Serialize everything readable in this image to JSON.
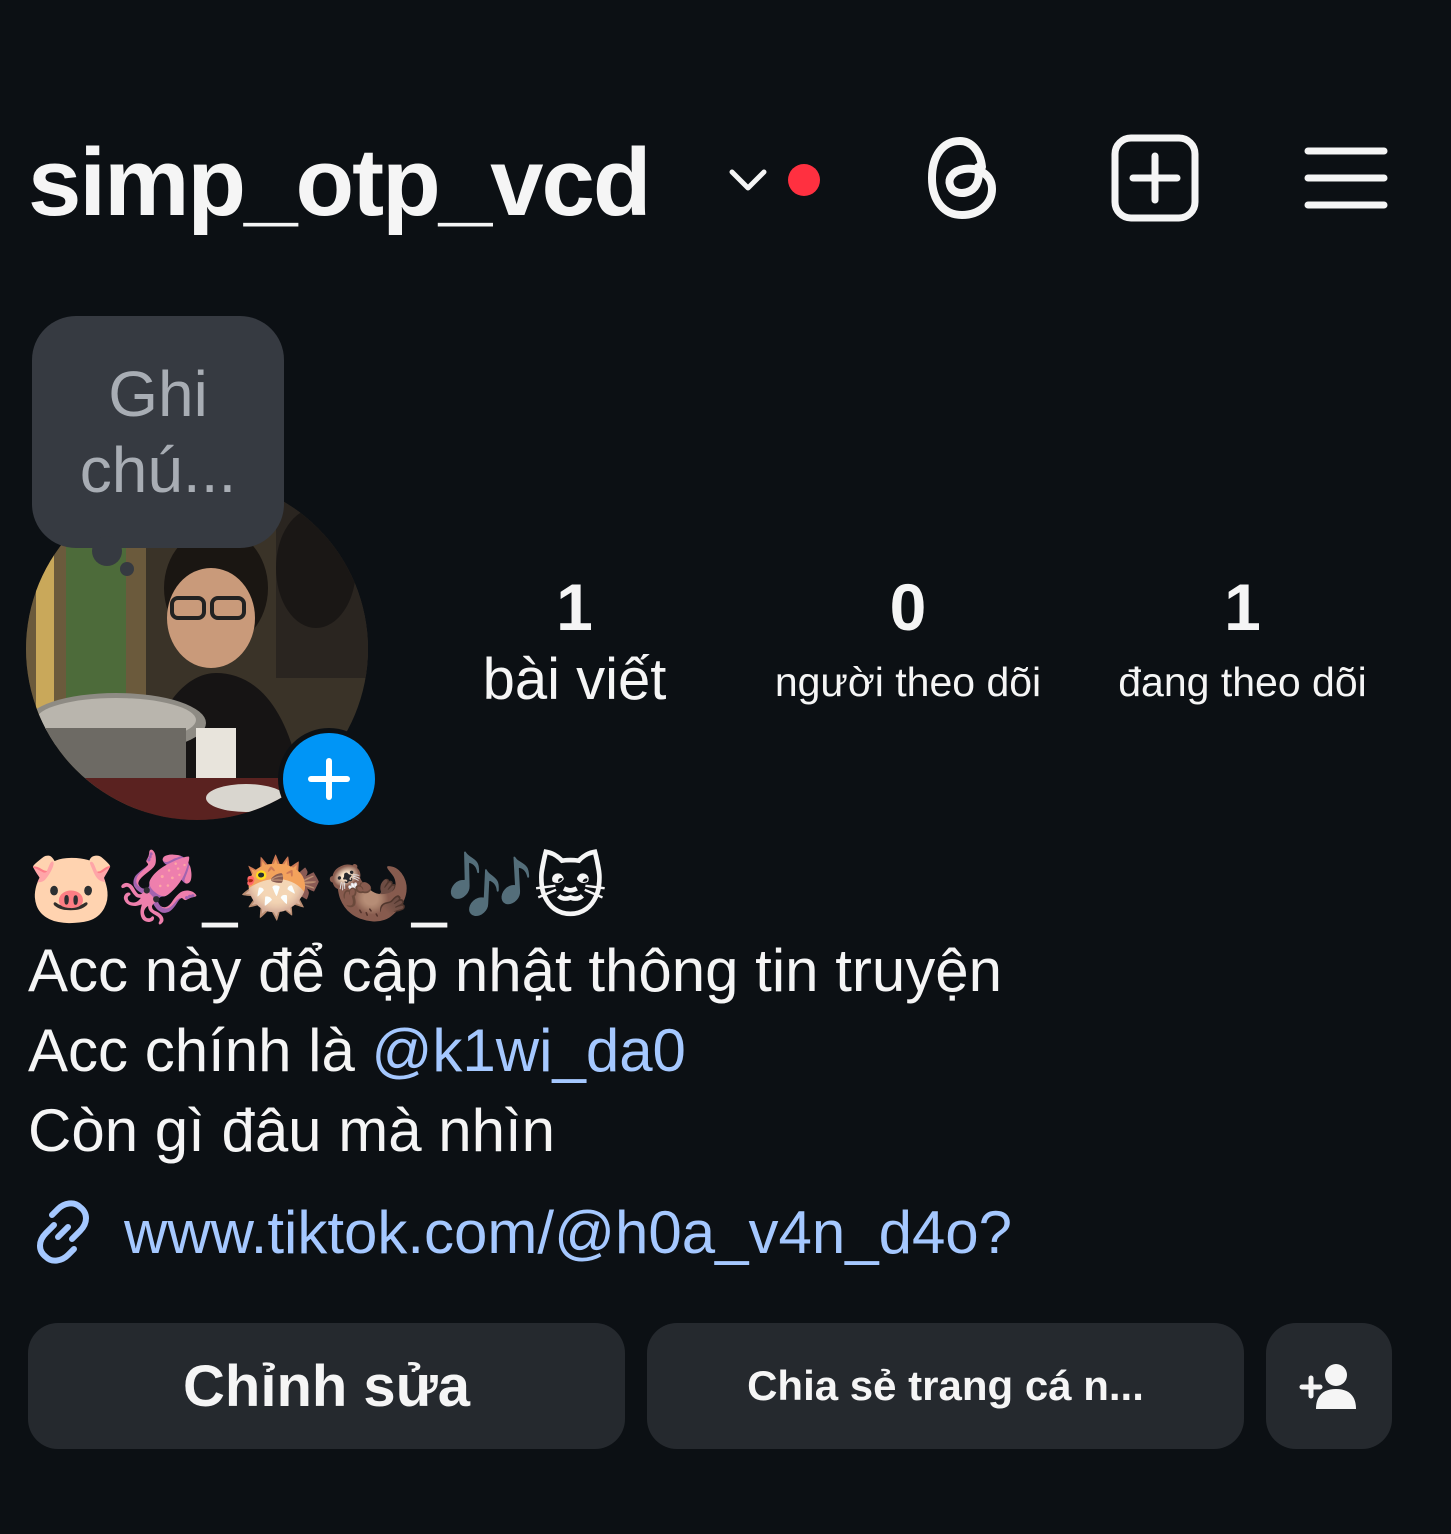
{
  "header": {
    "username": "simp_otp_vcd",
    "icons": [
      "chevron-down-icon",
      "threads-icon",
      "create-post-icon",
      "menu-icon"
    ],
    "notification_dot_color": "#ff3040"
  },
  "note": {
    "text_line1": "Ghi",
    "text_line2": "chú..."
  },
  "stats": {
    "posts": {
      "value": "1",
      "label": "bài viết"
    },
    "followers": {
      "value": "0",
      "label": "người theo dõi"
    },
    "following": {
      "value": "1",
      "label": "đang theo dõi"
    }
  },
  "bio": {
    "emoji_line": "🐷🦑_🐡🦦_🎶🐱",
    "line1": "Acc này để cập nhật thông tin truyện",
    "line2_prefix": "Acc chính là ",
    "line2_mention": "@k1wi_da0",
    "line3": "Còn gì đâu mà nhìn",
    "link": "www.tiktok.com/@h0a_v4n_d4o?"
  },
  "buttons": {
    "edit": "Chỉnh sửa",
    "share": "Chia sẻ trang cá n..."
  },
  "colors": {
    "background": "#0c1014",
    "button": "#25292e",
    "accent_link": "#a5c8ff",
    "add_story": "#0095f6"
  }
}
